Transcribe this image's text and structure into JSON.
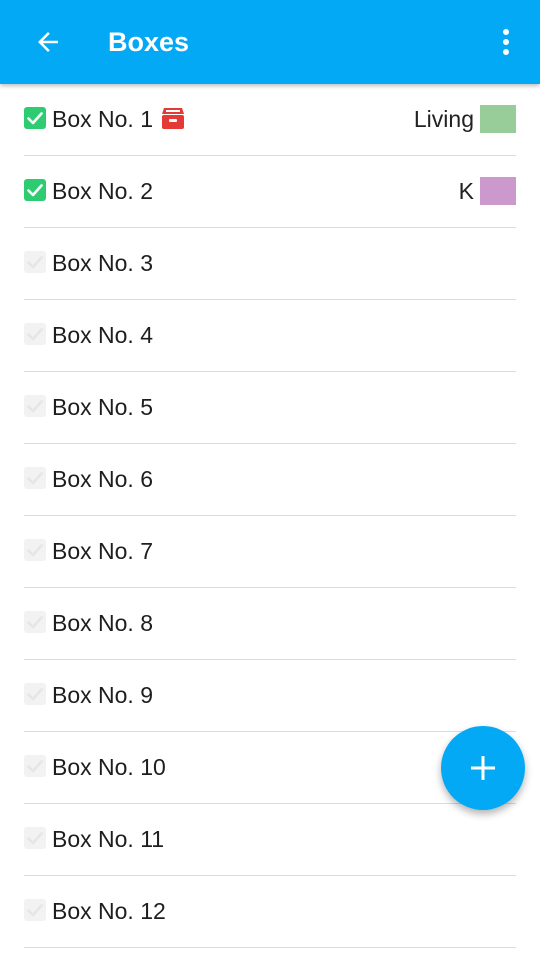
{
  "appbar": {
    "title": "Boxes",
    "back_icon": "arrow-left-icon",
    "menu_icon": "more-vert-icon",
    "color": "#03a9f4"
  },
  "boxes": [
    {
      "label": "Box No. 1",
      "checked": true,
      "has_icon": true,
      "icon": "archive-box-icon",
      "icon_color": "#e53935",
      "room": "Living",
      "room_color": "#98cc98"
    },
    {
      "label": "Box No. 2",
      "checked": true,
      "has_icon": false,
      "room": "K",
      "room_color": "#cc99cc"
    },
    {
      "label": "Box No. 3",
      "checked": false
    },
    {
      "label": "Box No. 4",
      "checked": false
    },
    {
      "label": "Box No. 5",
      "checked": false
    },
    {
      "label": "Box No. 6",
      "checked": false
    },
    {
      "label": "Box No. 7",
      "checked": false
    },
    {
      "label": "Box No. 8",
      "checked": false
    },
    {
      "label": "Box No. 9",
      "checked": false
    },
    {
      "label": "Box No. 10",
      "checked": false
    },
    {
      "label": "Box No. 11",
      "checked": false
    },
    {
      "label": "Box No. 12",
      "checked": false
    }
  ],
  "fab": {
    "icon": "plus-icon",
    "color": "#03a9f4"
  }
}
